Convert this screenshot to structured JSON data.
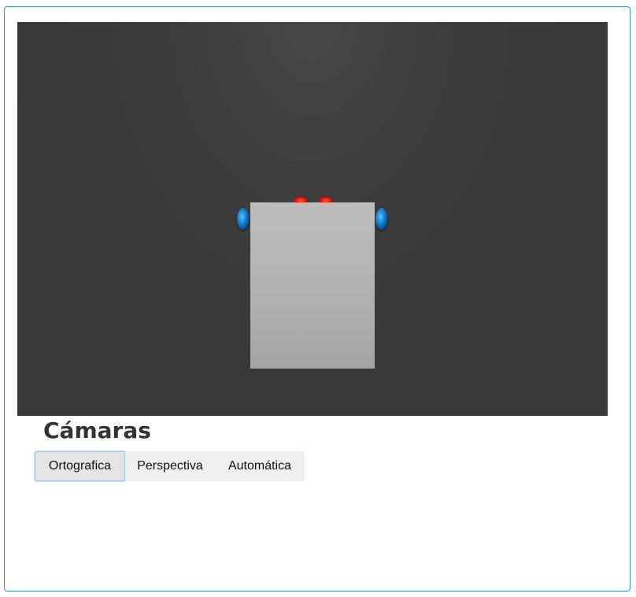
{
  "section": {
    "title": "Cámaras"
  },
  "camera_buttons": [
    {
      "label": "Ortografica",
      "active": true
    },
    {
      "label": "Perspectiva",
      "active": false
    },
    {
      "label": "Automática",
      "active": false
    }
  ],
  "scene": {
    "background_color": "#393939",
    "body_color": "#b4b4b4",
    "light_color": "#e01010",
    "wheel_color": "#1b86d6"
  }
}
